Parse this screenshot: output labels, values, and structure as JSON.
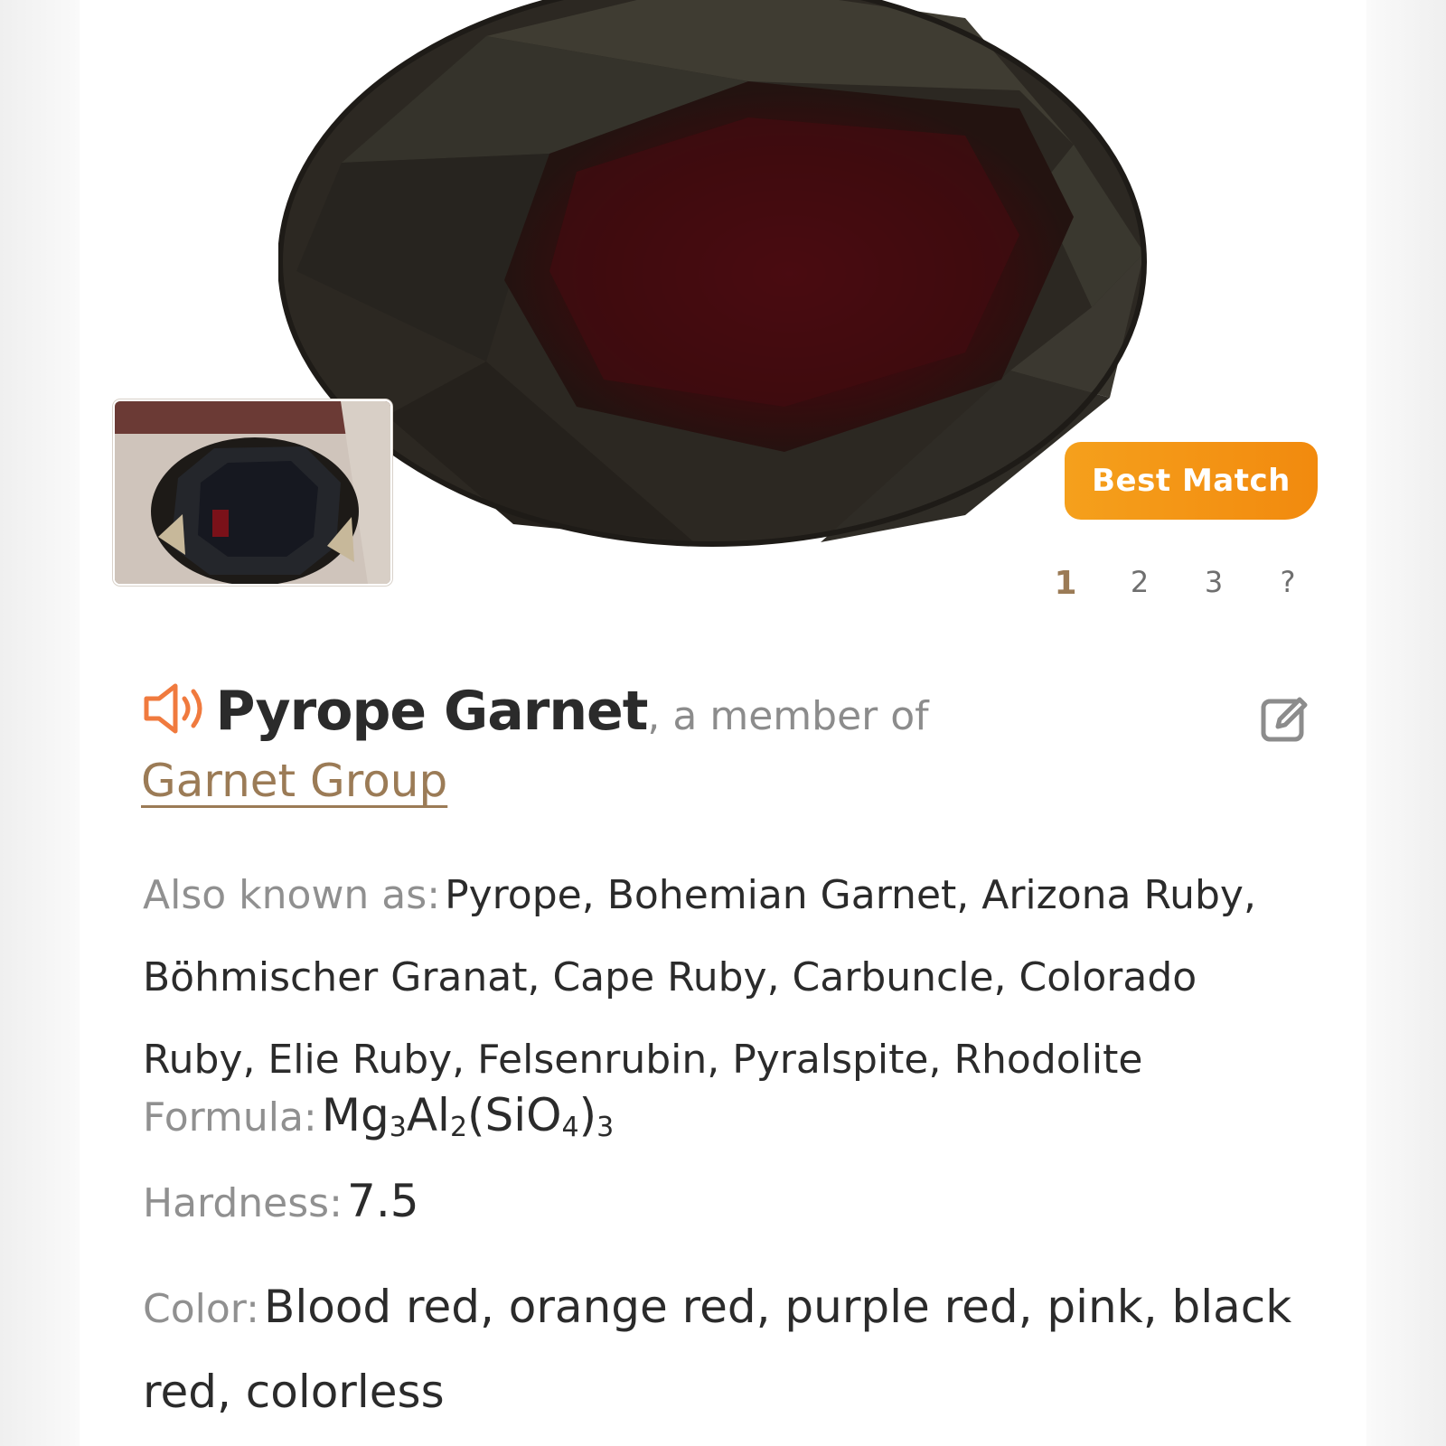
{
  "badge": {
    "label": "Best Match"
  },
  "pager": {
    "pages": [
      "1",
      "2",
      "3",
      "?"
    ],
    "active": "1"
  },
  "mineral": {
    "name": "Pyrope Garnet",
    "member_of_text": ", a member of",
    "group": "Garnet Group"
  },
  "details": {
    "aka_label": "Also known as:",
    "aka_value": "Pyrope, Bohemian Garnet, Arizona Ruby, Böhmischer Granat, Cape Ruby, Carbuncle, Colorado Ruby, Elie Ruby, Felsenrubin, Pyralspite, Rhodolite",
    "formula_label": "Formula:",
    "formula_parts": {
      "p1": "Mg",
      "s1": "3",
      "p2": "Al",
      "s2": "2",
      "p3": "(SiO",
      "s3": "4",
      "p4": ")",
      "s4": "3"
    },
    "hardness_label": "Hardness:",
    "hardness_value": "7.5",
    "color_label": "Color:",
    "color_value": "Blood red, orange red, purple red, pink, black red, colorless"
  },
  "icons": {
    "speaker": "speaker-icon",
    "edit": "edit-icon"
  },
  "colors": {
    "accent": "#9b7b56",
    "badge": "#f39a18",
    "speaker": "#f07a3e",
    "stone_dark": "#2a2520",
    "stone_red": "#4a0c10"
  }
}
